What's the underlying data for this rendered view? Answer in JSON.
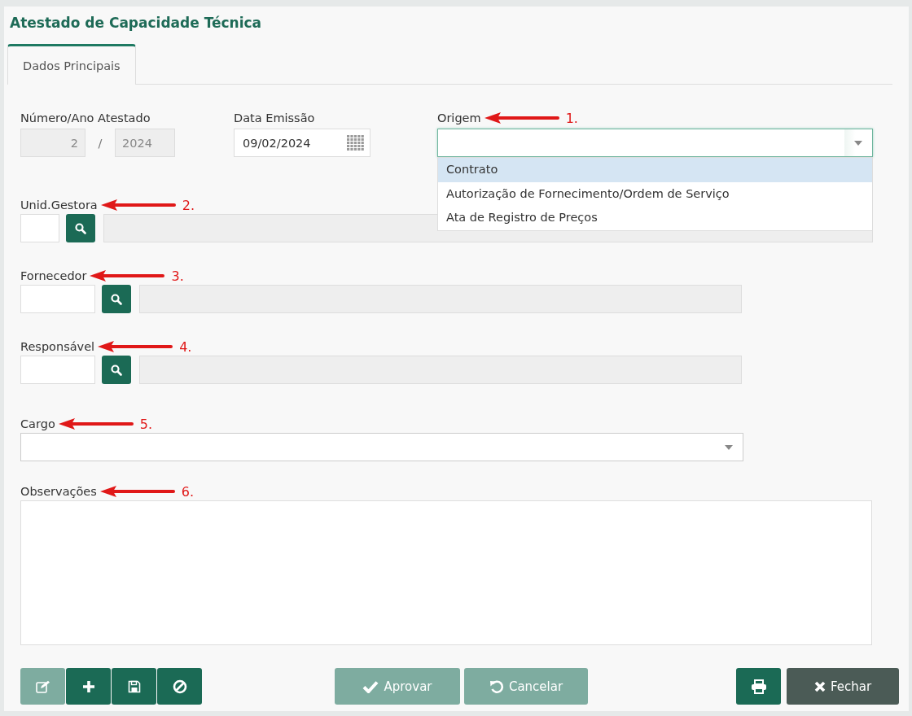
{
  "title": "Atestado de Capacidade Técnica",
  "tabs": [
    {
      "label": "Dados Principais",
      "selected": true
    }
  ],
  "numero": {
    "label": "Número/Ano Atestado",
    "number": "2",
    "separator": "/",
    "year": "2024",
    "disabled": true
  },
  "data_emissao": {
    "label": "Data Emissão",
    "value": "09/02/2024"
  },
  "origem": {
    "label": "Origem",
    "marker": "1.",
    "expanded": true,
    "options": [
      {
        "label": "Contrato",
        "selected": true
      },
      {
        "label": "Autorização de Fornecimento/Ordem de Serviço",
        "selected": false
      },
      {
        "label": "Ata de Registro de Preços",
        "selected": false
      }
    ]
  },
  "lookups": [
    {
      "label": "Unid.Gestora",
      "marker": "2.",
      "kind": "short"
    },
    {
      "label": "Fornecedor",
      "marker": "3.",
      "kind": "wide"
    },
    {
      "label": "Responsável",
      "marker": "4.",
      "kind": "wide"
    }
  ],
  "cargo": {
    "label": "Cargo",
    "marker": "5."
  },
  "observacoes": {
    "label": "Observações",
    "marker": "6."
  },
  "toolbar": [
    {
      "kind": "edit",
      "disabled": true
    },
    {
      "kind": "add",
      "disabled": false
    },
    {
      "kind": "save",
      "disabled": false
    },
    {
      "kind": "cancel",
      "disabled": false
    }
  ],
  "actions": [
    {
      "kind": "approve",
      "label": "Aprovar",
      "disabled": true
    },
    {
      "kind": "undo",
      "label": "Cancelar",
      "disabled": true
    }
  ],
  "right_buttons": [
    {
      "kind": "print"
    },
    {
      "kind": "close",
      "label": "Fechar"
    }
  ]
}
